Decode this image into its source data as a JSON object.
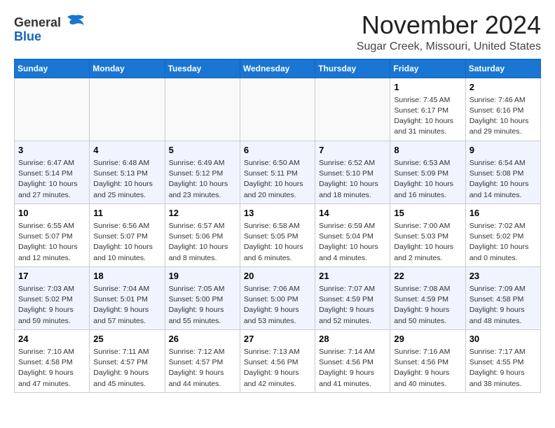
{
  "logo": {
    "general": "General",
    "blue": "Blue"
  },
  "title": "November 2024",
  "location": "Sugar Creek, Missouri, United States",
  "weekdays": [
    "Sunday",
    "Monday",
    "Tuesday",
    "Wednesday",
    "Thursday",
    "Friday",
    "Saturday"
  ],
  "weeks": [
    [
      {
        "day": "",
        "info": ""
      },
      {
        "day": "",
        "info": ""
      },
      {
        "day": "",
        "info": ""
      },
      {
        "day": "",
        "info": ""
      },
      {
        "day": "",
        "info": ""
      },
      {
        "day": "1",
        "info": "Sunrise: 7:45 AM\nSunset: 6:17 PM\nDaylight: 10 hours\nand 31 minutes."
      },
      {
        "day": "2",
        "info": "Sunrise: 7:46 AM\nSunset: 6:16 PM\nDaylight: 10 hours\nand 29 minutes."
      }
    ],
    [
      {
        "day": "3",
        "info": "Sunrise: 6:47 AM\nSunset: 5:14 PM\nDaylight: 10 hours\nand 27 minutes."
      },
      {
        "day": "4",
        "info": "Sunrise: 6:48 AM\nSunset: 5:13 PM\nDaylight: 10 hours\nand 25 minutes."
      },
      {
        "day": "5",
        "info": "Sunrise: 6:49 AM\nSunset: 5:12 PM\nDaylight: 10 hours\nand 23 minutes."
      },
      {
        "day": "6",
        "info": "Sunrise: 6:50 AM\nSunset: 5:11 PM\nDaylight: 10 hours\nand 20 minutes."
      },
      {
        "day": "7",
        "info": "Sunrise: 6:52 AM\nSunset: 5:10 PM\nDaylight: 10 hours\nand 18 minutes."
      },
      {
        "day": "8",
        "info": "Sunrise: 6:53 AM\nSunset: 5:09 PM\nDaylight: 10 hours\nand 16 minutes."
      },
      {
        "day": "9",
        "info": "Sunrise: 6:54 AM\nSunset: 5:08 PM\nDaylight: 10 hours\nand 14 minutes."
      }
    ],
    [
      {
        "day": "10",
        "info": "Sunrise: 6:55 AM\nSunset: 5:07 PM\nDaylight: 10 hours\nand 12 minutes."
      },
      {
        "day": "11",
        "info": "Sunrise: 6:56 AM\nSunset: 5:07 PM\nDaylight: 10 hours\nand 10 minutes."
      },
      {
        "day": "12",
        "info": "Sunrise: 6:57 AM\nSunset: 5:06 PM\nDaylight: 10 hours\nand 8 minutes."
      },
      {
        "day": "13",
        "info": "Sunrise: 6:58 AM\nSunset: 5:05 PM\nDaylight: 10 hours\nand 6 minutes."
      },
      {
        "day": "14",
        "info": "Sunrise: 6:59 AM\nSunset: 5:04 PM\nDaylight: 10 hours\nand 4 minutes."
      },
      {
        "day": "15",
        "info": "Sunrise: 7:00 AM\nSunset: 5:03 PM\nDaylight: 10 hours\nand 2 minutes."
      },
      {
        "day": "16",
        "info": "Sunrise: 7:02 AM\nSunset: 5:02 PM\nDaylight: 10 hours\nand 0 minutes."
      }
    ],
    [
      {
        "day": "17",
        "info": "Sunrise: 7:03 AM\nSunset: 5:02 PM\nDaylight: 9 hours\nand 59 minutes."
      },
      {
        "day": "18",
        "info": "Sunrise: 7:04 AM\nSunset: 5:01 PM\nDaylight: 9 hours\nand 57 minutes."
      },
      {
        "day": "19",
        "info": "Sunrise: 7:05 AM\nSunset: 5:00 PM\nDaylight: 9 hours\nand 55 minutes."
      },
      {
        "day": "20",
        "info": "Sunrise: 7:06 AM\nSunset: 5:00 PM\nDaylight: 9 hours\nand 53 minutes."
      },
      {
        "day": "21",
        "info": "Sunrise: 7:07 AM\nSunset: 4:59 PM\nDaylight: 9 hours\nand 52 minutes."
      },
      {
        "day": "22",
        "info": "Sunrise: 7:08 AM\nSunset: 4:59 PM\nDaylight: 9 hours\nand 50 minutes."
      },
      {
        "day": "23",
        "info": "Sunrise: 7:09 AM\nSunset: 4:58 PM\nDaylight: 9 hours\nand 48 minutes."
      }
    ],
    [
      {
        "day": "24",
        "info": "Sunrise: 7:10 AM\nSunset: 4:58 PM\nDaylight: 9 hours\nand 47 minutes."
      },
      {
        "day": "25",
        "info": "Sunrise: 7:11 AM\nSunset: 4:57 PM\nDaylight: 9 hours\nand 45 minutes."
      },
      {
        "day": "26",
        "info": "Sunrise: 7:12 AM\nSunset: 4:57 PM\nDaylight: 9 hours\nand 44 minutes."
      },
      {
        "day": "27",
        "info": "Sunrise: 7:13 AM\nSunset: 4:56 PM\nDaylight: 9 hours\nand 42 minutes."
      },
      {
        "day": "28",
        "info": "Sunrise: 7:14 AM\nSunset: 4:56 PM\nDaylight: 9 hours\nand 41 minutes."
      },
      {
        "day": "29",
        "info": "Sunrise: 7:16 AM\nSunset: 4:56 PM\nDaylight: 9 hours\nand 40 minutes."
      },
      {
        "day": "30",
        "info": "Sunrise: 7:17 AM\nSunset: 4:55 PM\nDaylight: 9 hours\nand 38 minutes."
      }
    ]
  ]
}
